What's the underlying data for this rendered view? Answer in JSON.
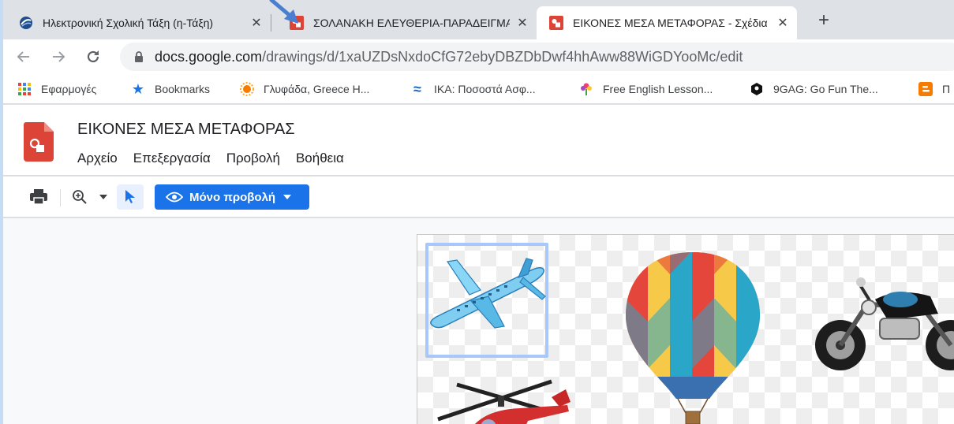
{
  "tabs": [
    {
      "title": "Ηλεκτρονική Σχολική Τάξη (η-Τάξη)",
      "favicon": "eclass-icon",
      "active": false
    },
    {
      "title": "ΣΟΛΑΝΑΚΗ ΕΛΕΥΘΕΡΙΑ-ΠΑΡΑΔΕΙΓΜΑ",
      "favicon": "drawings-icon",
      "active": false
    },
    {
      "title": "ΕΙΚΟΝΕΣ ΜΕΣΑ ΜΕΤΑΦΟΡΑΣ - Σχέδια Google",
      "favicon": "drawings-icon",
      "active": true
    }
  ],
  "toolbar": {
    "url_host": "docs.google.com",
    "url_path": "/drawings/d/1xaUZDsNxdoCfG72ebyDBZDbDwf4hhAww88WiGDYooMc/edit"
  },
  "bookmarks": [
    {
      "label": "Εφαρμογές",
      "icon": "apps-grid-icon"
    },
    {
      "label": "Bookmarks",
      "icon": "star-icon"
    },
    {
      "label": "Γλυφάδα, Greece H...",
      "icon": "sun-icon"
    },
    {
      "label": "ΙΚΑ: Ποσοστά Ασφ...",
      "icon": "waves-icon"
    },
    {
      "label": "Free English Lesson...",
      "icon": "flower-icon"
    },
    {
      "label": "9GAG: Go Fun The...",
      "icon": "9gag-icon"
    },
    {
      "label": "Π",
      "icon": "blogger-icon"
    }
  ],
  "document": {
    "title": "ΕΙΚΟΝΕΣ ΜΕΣΑ ΜΕΤΑΦΟΡΑΣ",
    "menus": [
      "Αρχείο",
      "Επεξεργασία",
      "Προβολή",
      "Βοήθεια"
    ]
  },
  "drawtools": {
    "view_only_label": "Μόνο προβολή"
  },
  "colors": {
    "accent": "#1a73e8",
    "tab_strip": "#dee1e6",
    "drawings_red": "#db4437",
    "selection": "#a8c7fa"
  }
}
